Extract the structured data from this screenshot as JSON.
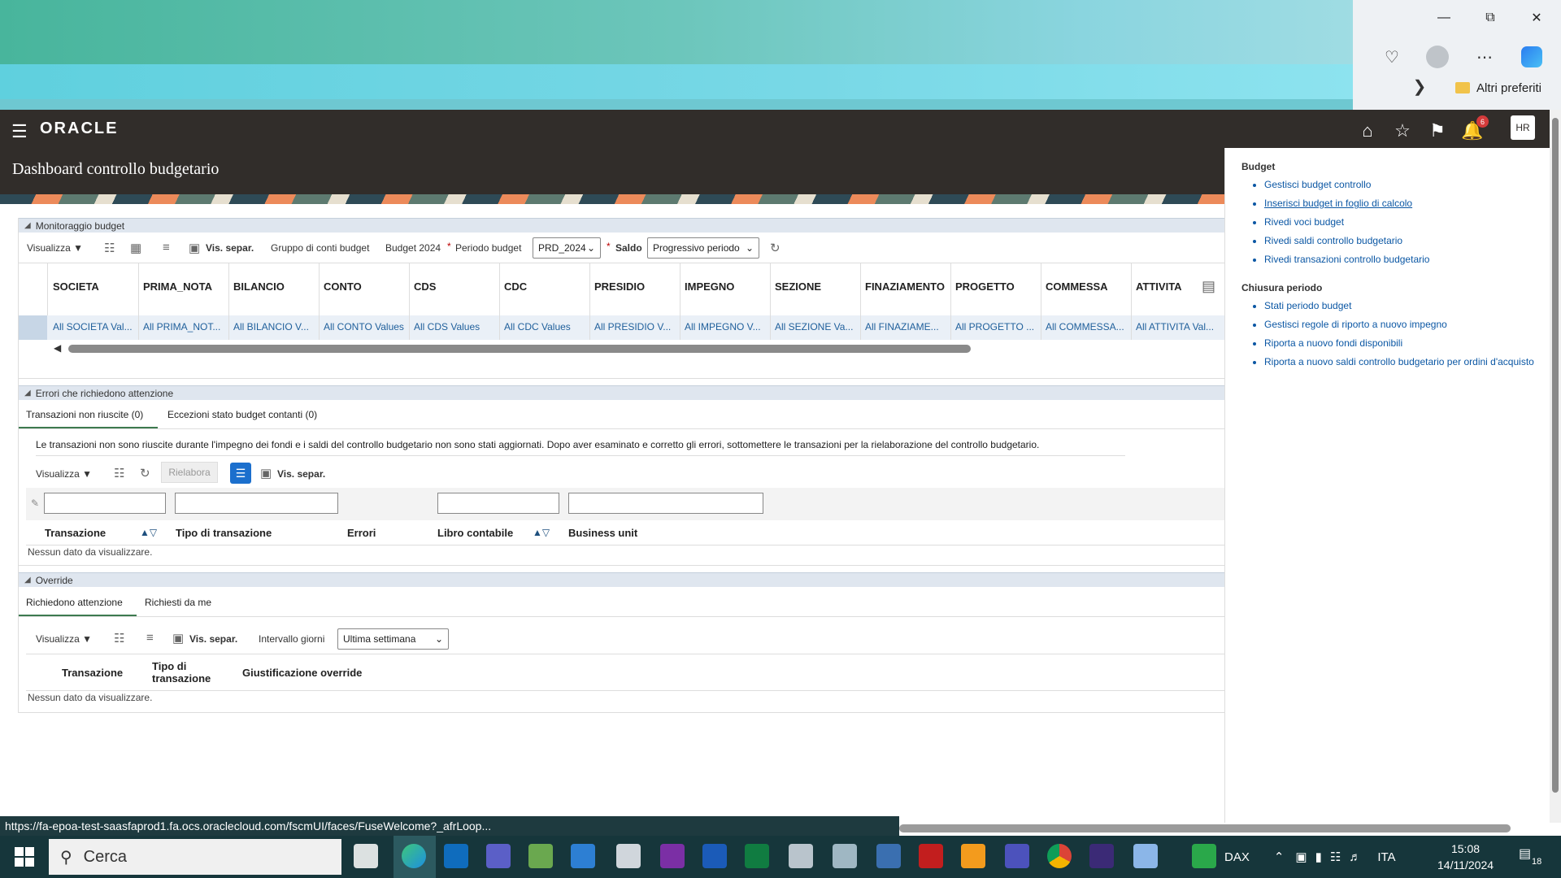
{
  "browser": {
    "favorites_label": "Altri preferiti"
  },
  "oracle": {
    "logo": "ORACLE",
    "page_title": "Dashboard controllo budgetario",
    "notification_count": "6",
    "user_initials": "HR"
  },
  "monitor": {
    "section_title": "Monitoraggio budget",
    "view_label": "Visualizza",
    "detach_label": "Vis. separ.",
    "budget_group_label": "Gruppo di conti budget",
    "budget_group_value": "Budget 2024",
    "period_label": "Periodo budget",
    "period_value": "PRD_2024",
    "balance_label": "Saldo",
    "balance_value": "Progressivo periodo",
    "columns": [
      "SOCIETA",
      "PRIMA_NOTA",
      "BILANCIO",
      "CONTO",
      "CDS",
      "CDC",
      "PRESIDIO",
      "IMPEGNO",
      "SEZIONE",
      "FINAZIAMENTO",
      "PROGETTO",
      "COMMESSA",
      "ATTIVITA"
    ],
    "values": [
      "All SOCIETA Val...",
      "All PRIMA_NOT...",
      "All BILANCIO V...",
      "All CONTO Values",
      "All CDS Values",
      "All CDC Values",
      "All PRESIDIO V...",
      "All IMPEGNO V...",
      "All SEZIONE Va...",
      "All FINAZIAME...",
      "All PROGETTO ...",
      "All COMMESSA...",
      "All ATTIVITA Val..."
    ]
  },
  "errors": {
    "section_title": "Errori che richiedono attenzione",
    "tab1": "Transazioni non riuscite (0)",
    "tab2": "Eccezioni stato budget contanti (0)",
    "message": "Le transazioni non sono riuscite durante l'impegno dei fondi e i saldi del controllo budgetario non sono stati aggiornati. Dopo aver esaminato e corretto gli errori, sottomettere le transazioni per la rielaborazione del controllo budgetario.",
    "view_label": "Visualizza",
    "reprocess_label": "Rielabora",
    "detach_label": "Vis. separ.",
    "col_transaction": "Transazione",
    "col_type": "Tipo di transazione",
    "col_errors": "Errori",
    "col_ledger": "Libro contabile",
    "col_bu": "Business unit",
    "no_data": "Nessun dato da visualizzare."
  },
  "override": {
    "section_title": "Override",
    "tab1": "Richiedono attenzione",
    "tab2": "Richiesti da me",
    "view_label": "Visualizza",
    "detach_label": "Vis. separ.",
    "range_label": "Intervallo giorni",
    "range_value": "Ultima settimana",
    "col_transaction": "Transazione",
    "col_type_line1": "Tipo di",
    "col_type_line2": "transazione",
    "col_justification": "Giustificazione override",
    "no_data": "Nessun dato da visualizzare."
  },
  "side_panel": {
    "budget_title": "Budget",
    "budget_links": [
      "Gestisci budget controllo",
      "Inserisci budget in foglio di calcolo",
      "Rivedi voci budget",
      "Rivedi saldi controllo budgetario",
      "Rivedi transazioni controllo budgetario"
    ],
    "closing_title": "Chiusura periodo",
    "closing_links": [
      "Stati periodo budget",
      "Gestisci regole di riporto a nuovo impegno",
      "Riporta a nuovo fondi disponibili",
      "Riporta a nuovo saldi controllo budgetario per ordini d'acquisto"
    ]
  },
  "status_url": "https://fa-epoa-test-saasfaprod1.fa.ocs.oraclecloud.com/fscmUI/faces/FuseWelcome?_afrLoop...",
  "taskbar": {
    "search_placeholder": "Cerca",
    "dax_label": "DAX",
    "language": "ITA",
    "time": "15:08",
    "date": "14/11/2024",
    "notif_count": "18"
  }
}
